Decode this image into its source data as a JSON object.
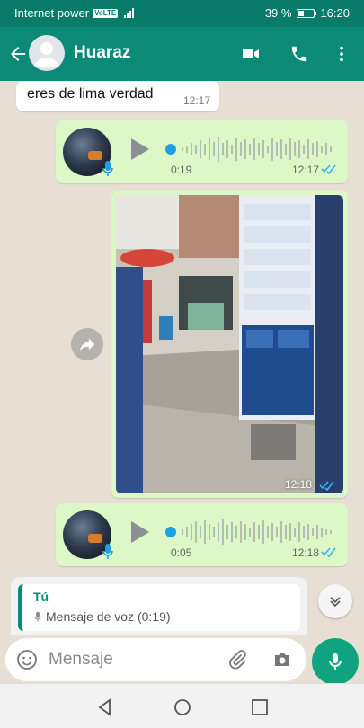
{
  "status_bar": {
    "carrier": "Internet power",
    "network_badge": "VoLTE",
    "battery_percent": "39 %",
    "time": "16:20"
  },
  "header": {
    "back_icon": "arrow-left-icon",
    "contact_name": "Huaraz",
    "actions": [
      "video-call-icon",
      "phone-icon",
      "more-vert-icon"
    ]
  },
  "messages": {
    "incoming_text": {
      "text": "eres de lima verdad",
      "time": "12:17"
    },
    "voice_1": {
      "duration": "0:19",
      "time": "12:17",
      "status": "read"
    },
    "image": {
      "time": "12:18",
      "status": "read"
    },
    "voice_2": {
      "duration": "0:05",
      "time": "12:18",
      "status": "read"
    }
  },
  "reply_preview": {
    "author": "Tú",
    "text": "Mensaje de voz (0:19)"
  },
  "composer": {
    "placeholder": "Mensaje"
  },
  "colors": {
    "header": "#0b8a77",
    "status_bar": "#0a7a6a",
    "outgoing_bubble": "#dcf8c6",
    "read_ticks": "#34b7f1",
    "mic_button": "#0fa37f"
  }
}
